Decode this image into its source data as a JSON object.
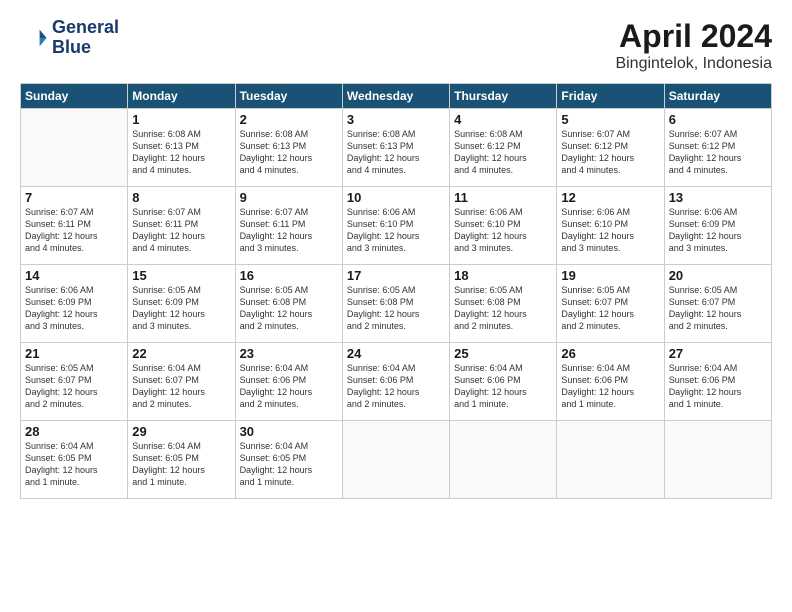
{
  "header": {
    "logo_line1": "General",
    "logo_line2": "Blue",
    "title": "April 2024",
    "subtitle": "Bingintelok, Indonesia"
  },
  "weekdays": [
    "Sunday",
    "Monday",
    "Tuesday",
    "Wednesday",
    "Thursday",
    "Friday",
    "Saturday"
  ],
  "weeks": [
    [
      {
        "day": "",
        "info": ""
      },
      {
        "day": "1",
        "info": "Sunrise: 6:08 AM\nSunset: 6:13 PM\nDaylight: 12 hours\nand 4 minutes."
      },
      {
        "day": "2",
        "info": "Sunrise: 6:08 AM\nSunset: 6:13 PM\nDaylight: 12 hours\nand 4 minutes."
      },
      {
        "day": "3",
        "info": "Sunrise: 6:08 AM\nSunset: 6:13 PM\nDaylight: 12 hours\nand 4 minutes."
      },
      {
        "day": "4",
        "info": "Sunrise: 6:08 AM\nSunset: 6:12 PM\nDaylight: 12 hours\nand 4 minutes."
      },
      {
        "day": "5",
        "info": "Sunrise: 6:07 AM\nSunset: 6:12 PM\nDaylight: 12 hours\nand 4 minutes."
      },
      {
        "day": "6",
        "info": "Sunrise: 6:07 AM\nSunset: 6:12 PM\nDaylight: 12 hours\nand 4 minutes."
      }
    ],
    [
      {
        "day": "7",
        "info": "Sunrise: 6:07 AM\nSunset: 6:11 PM\nDaylight: 12 hours\nand 4 minutes."
      },
      {
        "day": "8",
        "info": "Sunrise: 6:07 AM\nSunset: 6:11 PM\nDaylight: 12 hours\nand 4 minutes."
      },
      {
        "day": "9",
        "info": "Sunrise: 6:07 AM\nSunset: 6:11 PM\nDaylight: 12 hours\nand 3 minutes."
      },
      {
        "day": "10",
        "info": "Sunrise: 6:06 AM\nSunset: 6:10 PM\nDaylight: 12 hours\nand 3 minutes."
      },
      {
        "day": "11",
        "info": "Sunrise: 6:06 AM\nSunset: 6:10 PM\nDaylight: 12 hours\nand 3 minutes."
      },
      {
        "day": "12",
        "info": "Sunrise: 6:06 AM\nSunset: 6:10 PM\nDaylight: 12 hours\nand 3 minutes."
      },
      {
        "day": "13",
        "info": "Sunrise: 6:06 AM\nSunset: 6:09 PM\nDaylight: 12 hours\nand 3 minutes."
      }
    ],
    [
      {
        "day": "14",
        "info": "Sunrise: 6:06 AM\nSunset: 6:09 PM\nDaylight: 12 hours\nand 3 minutes."
      },
      {
        "day": "15",
        "info": "Sunrise: 6:05 AM\nSunset: 6:09 PM\nDaylight: 12 hours\nand 3 minutes."
      },
      {
        "day": "16",
        "info": "Sunrise: 6:05 AM\nSunset: 6:08 PM\nDaylight: 12 hours\nand 2 minutes."
      },
      {
        "day": "17",
        "info": "Sunrise: 6:05 AM\nSunset: 6:08 PM\nDaylight: 12 hours\nand 2 minutes."
      },
      {
        "day": "18",
        "info": "Sunrise: 6:05 AM\nSunset: 6:08 PM\nDaylight: 12 hours\nand 2 minutes."
      },
      {
        "day": "19",
        "info": "Sunrise: 6:05 AM\nSunset: 6:07 PM\nDaylight: 12 hours\nand 2 minutes."
      },
      {
        "day": "20",
        "info": "Sunrise: 6:05 AM\nSunset: 6:07 PM\nDaylight: 12 hours\nand 2 minutes."
      }
    ],
    [
      {
        "day": "21",
        "info": "Sunrise: 6:05 AM\nSunset: 6:07 PM\nDaylight: 12 hours\nand 2 minutes."
      },
      {
        "day": "22",
        "info": "Sunrise: 6:04 AM\nSunset: 6:07 PM\nDaylight: 12 hours\nand 2 minutes."
      },
      {
        "day": "23",
        "info": "Sunrise: 6:04 AM\nSunset: 6:06 PM\nDaylight: 12 hours\nand 2 minutes."
      },
      {
        "day": "24",
        "info": "Sunrise: 6:04 AM\nSunset: 6:06 PM\nDaylight: 12 hours\nand 2 minutes."
      },
      {
        "day": "25",
        "info": "Sunrise: 6:04 AM\nSunset: 6:06 PM\nDaylight: 12 hours\nand 1 minute."
      },
      {
        "day": "26",
        "info": "Sunrise: 6:04 AM\nSunset: 6:06 PM\nDaylight: 12 hours\nand 1 minute."
      },
      {
        "day": "27",
        "info": "Sunrise: 6:04 AM\nSunset: 6:06 PM\nDaylight: 12 hours\nand 1 minute."
      }
    ],
    [
      {
        "day": "28",
        "info": "Sunrise: 6:04 AM\nSunset: 6:05 PM\nDaylight: 12 hours\nand 1 minute."
      },
      {
        "day": "29",
        "info": "Sunrise: 6:04 AM\nSunset: 6:05 PM\nDaylight: 12 hours\nand 1 minute."
      },
      {
        "day": "30",
        "info": "Sunrise: 6:04 AM\nSunset: 6:05 PM\nDaylight: 12 hours\nand 1 minute."
      },
      {
        "day": "",
        "info": ""
      },
      {
        "day": "",
        "info": ""
      },
      {
        "day": "",
        "info": ""
      },
      {
        "day": "",
        "info": ""
      }
    ]
  ]
}
